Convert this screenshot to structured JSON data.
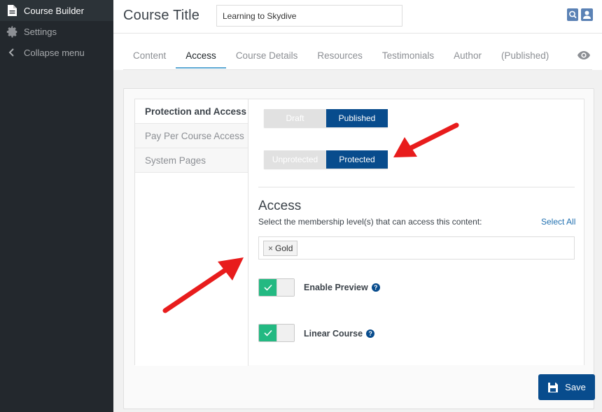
{
  "sidebar": {
    "items": [
      {
        "label": "Course Builder",
        "icon": "document-icon"
      },
      {
        "label": "Settings",
        "icon": "gear-icon"
      },
      {
        "label": "Collapse menu",
        "icon": "chevron-left-icon"
      }
    ]
  },
  "header": {
    "title": "Course Title",
    "course_title_value": "Learning to Skydive"
  },
  "tabs": [
    {
      "label": "Content"
    },
    {
      "label": "Access"
    },
    {
      "label": "Course Details"
    },
    {
      "label": "Resources"
    },
    {
      "label": "Testimonials"
    },
    {
      "label": "Author"
    },
    {
      "label": "(Published)"
    }
  ],
  "subnav": [
    {
      "label": "Protection and Access"
    },
    {
      "label": "Pay Per Course Access"
    },
    {
      "label": "System Pages"
    }
  ],
  "status_toggle": {
    "off_label": "Draft",
    "on_label": "Published",
    "selected": "Published"
  },
  "protection_toggle": {
    "off_label": "Unprotected",
    "on_label": "Protected",
    "selected": "Protected"
  },
  "access": {
    "title": "Access",
    "description": "Select the membership level(s) that can access this content:",
    "select_all": "Select All",
    "tags": [
      "Gold"
    ],
    "remove_symbol": "×"
  },
  "options": {
    "enable_preview": {
      "label": "Enable Preview",
      "enabled": true
    },
    "linear_course": {
      "label": "Linear Course",
      "enabled": true
    },
    "help_symbol": "?"
  },
  "save_label": "Save",
  "colors": {
    "primary": "#084c8d",
    "toggle_on": "#23b982",
    "annotation_arrow": "#e81c1c",
    "tab_underline": "#5da9d4"
  }
}
